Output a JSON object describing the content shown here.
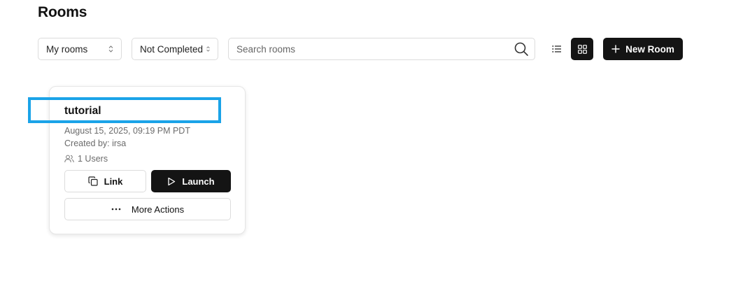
{
  "page": {
    "title": "Rooms"
  },
  "filters": {
    "ownership": {
      "selected": "My rooms"
    },
    "status": {
      "selected": "Not Completed"
    }
  },
  "search": {
    "placeholder": "Search rooms",
    "value": ""
  },
  "view_toggle": {
    "list_icon": "list-icon",
    "grid_icon": "grid-icon",
    "active": "grid"
  },
  "toolbar": {
    "new_room_label": "New Room"
  },
  "rooms": [
    {
      "name": "tutorial",
      "date": "August 15, 2025, 09:19 PM PDT",
      "created_by": "Created by: irsa",
      "users": "1 Users",
      "link_label": "Link",
      "launch_label": "Launch",
      "more_label": "More Actions"
    }
  ],
  "colors": {
    "primary": "#141414",
    "highlight": "#1aa3e8",
    "muted": "#6b6b6b",
    "border": "#dcdcdc"
  }
}
